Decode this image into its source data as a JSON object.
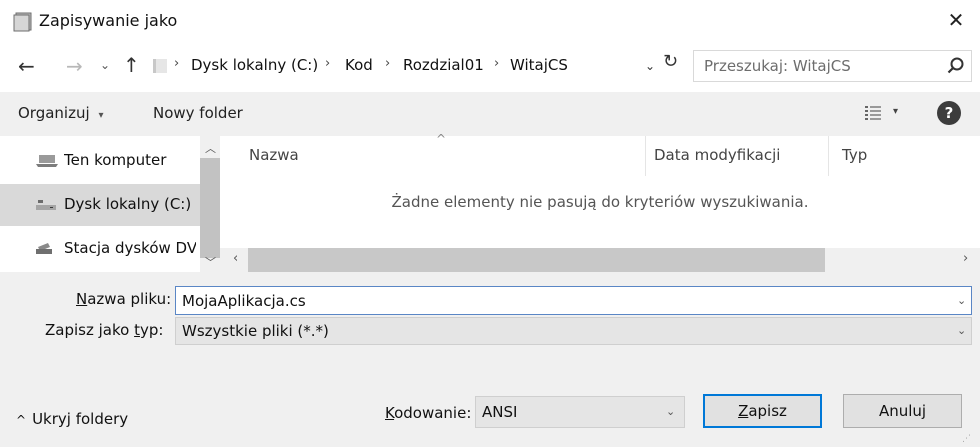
{
  "window": {
    "title": "Zapisywanie jako",
    "close_glyph": "✕",
    "icon": "save-dialog-icon"
  },
  "navigation": {
    "back_glyph": "←",
    "forward_glyph": "→",
    "recent_glyph": "⌄",
    "up_glyph": "↑",
    "breadcrumbs": [
      {
        "label": "Dysk lokalny (C:)"
      },
      {
        "label": "Kod"
      },
      {
        "label": "Rozdzial01"
      },
      {
        "label": "WitajCS"
      }
    ],
    "breadcrumb_separator": "›",
    "refresh_glyph": "↻",
    "search_placeholder": "Przeszukaj: WitajCS"
  },
  "toolbar": {
    "organize_label": "Organizuj",
    "organize_caret": "▾",
    "new_folder_label": "Nowy folder",
    "view_caret": "▾",
    "help_glyph": "?"
  },
  "sidebar": {
    "items": [
      {
        "label": "Ten komputer",
        "icon": "computer-icon",
        "selected": false
      },
      {
        "label": "Dysk lokalny (C:)",
        "icon": "drive-icon",
        "selected": true
      },
      {
        "label": "Stacja dysków DVD",
        "icon": "dvd-drive-icon",
        "selected": false
      }
    ]
  },
  "file_list": {
    "columns": [
      "Nazwa",
      "Data modyfikacji",
      "Typ"
    ],
    "empty_message": "Żadne elementy nie pasują do kryteriów wyszukiwania."
  },
  "form": {
    "filename_label_accel": "N",
    "filename_label_rest": "azwa pliku:",
    "filename_value": "MojaAplikacja.cs",
    "filetype_label_pre": "Zapisz jako ",
    "filetype_label_accel": "t",
    "filetype_label_rest": "yp:",
    "filetype_value": "Wszystkie pliki  (*.*)",
    "hide_folders_label": "Ukryj foldery",
    "hide_folders_glyph": "^",
    "encoding_label_accel": "K",
    "encoding_label_rest": "odowanie:",
    "encoding_value": "ANSI",
    "save_accel": "Z",
    "save_rest": "apisz",
    "cancel_label": "Anuluj"
  },
  "colors": {
    "focus_blue": "#0078d7",
    "selected_bg": "#d9d9d9",
    "toolbar_bg": "#f0f0f0"
  }
}
